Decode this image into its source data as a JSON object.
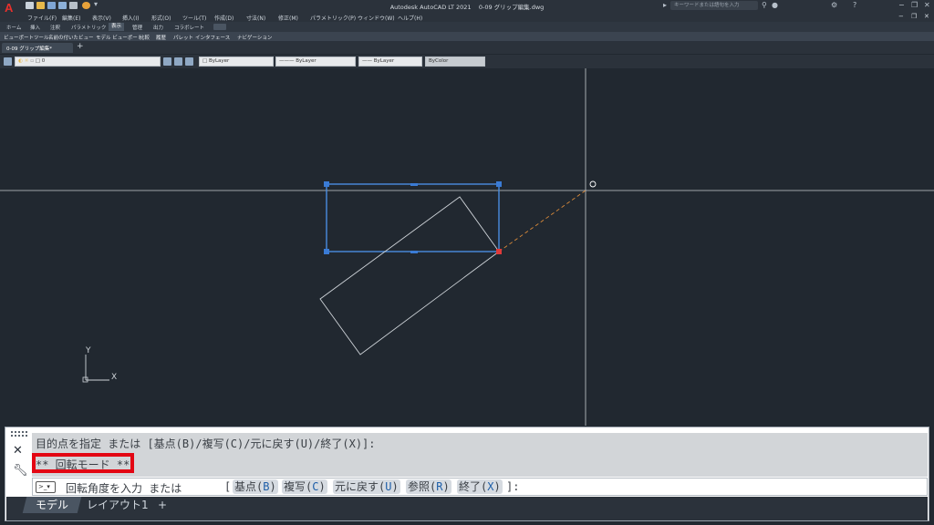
{
  "app": {
    "title": "Autodesk AutoCAD LT 2021",
    "filename": "0-09 グリップ編集.dwg",
    "logo": "A",
    "search_placeholder": "キーワードまたは語句を入力"
  },
  "menu": [
    "ファイル(F)",
    "編集(E)",
    "表示(V)",
    "挿入(I)",
    "形式(O)",
    "ツール(T)",
    "作成(D)",
    "寸法(N)",
    "修正(M)",
    "パラメトリック(P)",
    "ウィンドウ(W)",
    "ヘルプ(H)"
  ],
  "ribbon_tabs": [
    "ホーム",
    "挿入",
    "注釈",
    "パラメトリック",
    "表示",
    "管理",
    "出力",
    "コラボレート"
  ],
  "ribbon_active_tab": "表示",
  "ribbon_panels": [
    "ビューポートツール",
    "名前の付いたビュー",
    "モデル ビューポート",
    "比較",
    "履歴",
    "パレット",
    "インタフェース",
    "ナビゲーション"
  ],
  "document_tab": "0-09 グリップ編集*",
  "properties_toolbar": {
    "layer_value": "0",
    "color": "ByLayer",
    "linetype": "ByLayer",
    "lineweight": "ByLayer",
    "plotstyle": "ByColor"
  },
  "ucs": {
    "x_label": "X",
    "y_label": "Y"
  },
  "command": {
    "history_line1": "目的点を指定 または [基点(B)/複写(C)/元に戻す(U)/終了(X)]:",
    "history_line2": "** 回転モード **",
    "prompt_text": "回転角度を入力 または",
    "bracket_open": "[",
    "options": [
      {
        "label": "基点(",
        "key": "B",
        "close": ")"
      },
      {
        "label": "複写(",
        "key": "C",
        "close": ")"
      },
      {
        "label": "元に戻す(",
        "key": "U",
        "close": ")"
      },
      {
        "label": "参照(",
        "key": "R",
        "close": ")"
      },
      {
        "label": "終了(",
        "key": "X",
        "close": ")"
      }
    ],
    "bracket_close": "]:"
  },
  "layout_tabs": [
    "モデル",
    "レイアウト1"
  ],
  "add_layout": "+",
  "colors": {
    "canvas": "#212830",
    "grip_blue": "#3a7bd5",
    "selected_rect": "#4a8de0",
    "rotation_base": "#e03a3a",
    "rubber_band": "#d98a3a",
    "highlight": "#e30613"
  }
}
